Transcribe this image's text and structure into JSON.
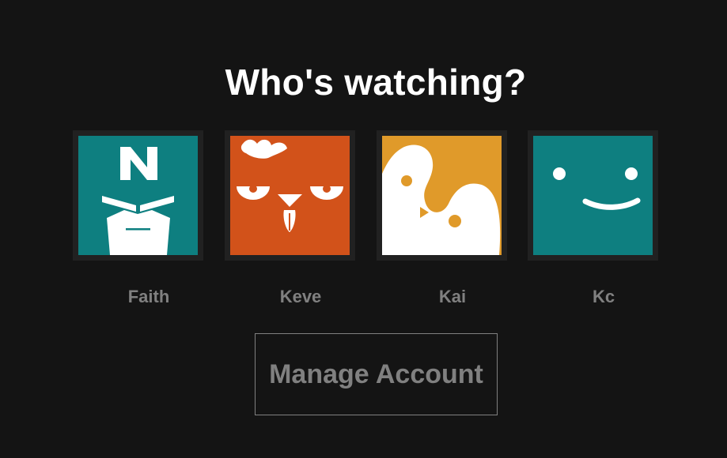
{
  "page": {
    "title": "Who's watching?"
  },
  "profiles": [
    {
      "name": "Faith",
      "avatar_icon": "masked-hero-icon",
      "avatar_color": "#0e7f80"
    },
    {
      "name": "Keve",
      "avatar_icon": "chicken-face-icon",
      "avatar_color": "#d2521a"
    },
    {
      "name": "Kai",
      "avatar_icon": "bird-shapes-icon",
      "avatar_color": "#e09a2a"
    },
    {
      "name": "Kc",
      "avatar_icon": "smiley-face-icon",
      "avatar_color": "#0e7f80"
    }
  ],
  "manage_account": {
    "label": "Manage Account"
  },
  "colors": {
    "background": "#141414",
    "title_text": "#ffffff",
    "muted_text": "#808080"
  }
}
